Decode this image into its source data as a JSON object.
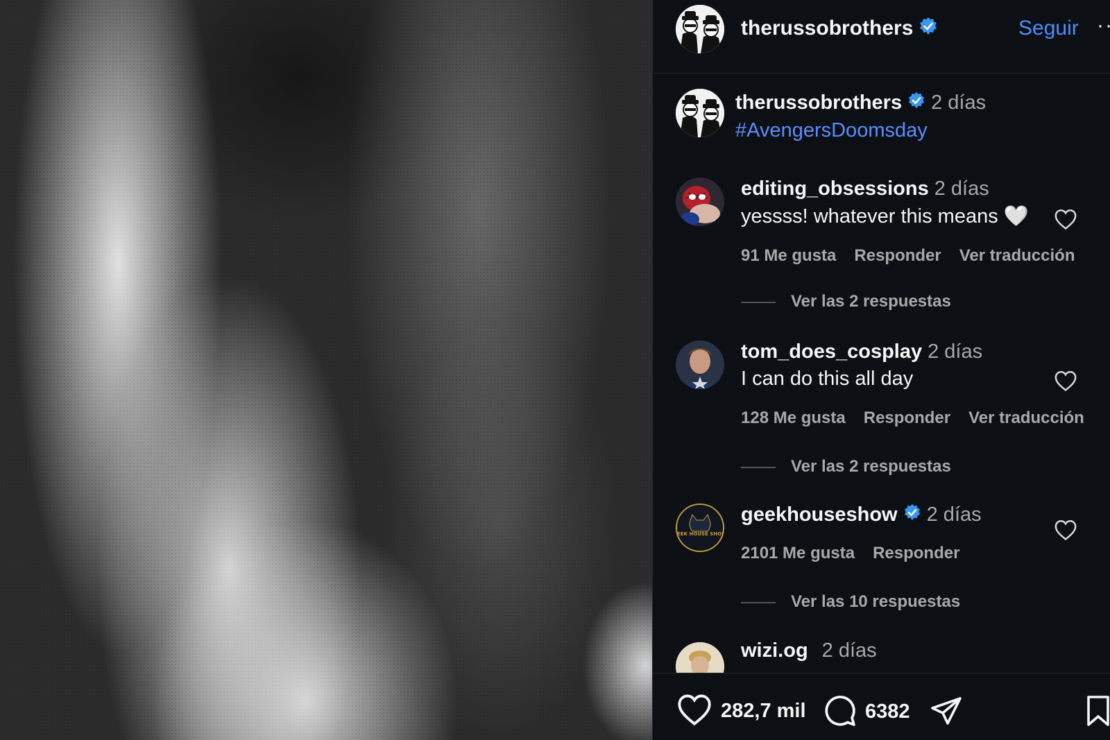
{
  "post": {
    "author": "therussobrothers",
    "follow_label": "Seguir",
    "more_label": "··",
    "caption_time": "2 días",
    "caption_hashtag": "#AvengersDoomsday"
  },
  "comments": [
    {
      "username": "editing_obsessions",
      "time": "2 días",
      "text": "yessss! whatever this means 🤍",
      "likes": "91 Me gusta",
      "reply": "Responder",
      "translate": "Ver traducción",
      "view_replies": "Ver las 2 respuestas"
    },
    {
      "username": "tom_does_cosplay",
      "time": "2 días",
      "text": "I can do this all day",
      "likes": "128 Me gusta",
      "reply": "Responder",
      "translate": "Ver traducción",
      "view_replies": "Ver las 2 respuestas"
    },
    {
      "username": "geekhouseshow",
      "time": "2 días",
      "likes": "2101 Me gusta",
      "reply": "Responder",
      "view_replies": "Ver las 10 respuestas",
      "avatar_text": "GEEK HOUSE SHOW"
    },
    {
      "username": "wizi.og",
      "time": "2 días"
    }
  ],
  "actions": {
    "like_count": "282,7 mil",
    "comment_count": "6382"
  },
  "colors": {
    "panel_bg": "#0c1014",
    "link_blue": "#4e8cff",
    "verified_blue": "#3897f0",
    "muted_text": "#a8a8a8"
  }
}
